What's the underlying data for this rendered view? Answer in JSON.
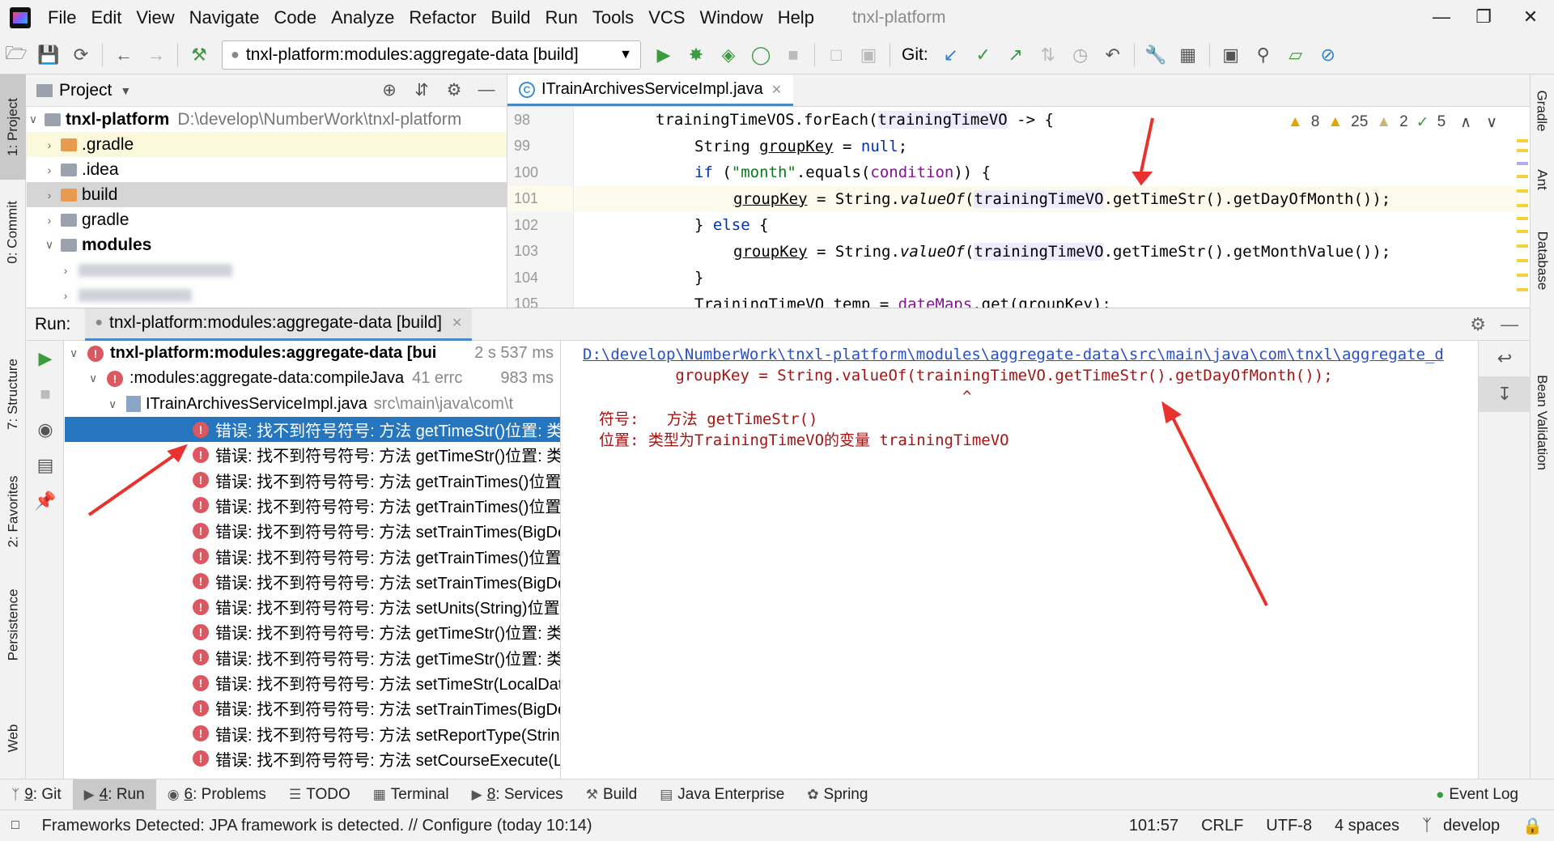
{
  "menubar": {
    "items": [
      "File",
      "Edit",
      "View",
      "Navigate",
      "Code",
      "Analyze",
      "Refactor",
      "Build",
      "Run",
      "Tools",
      "VCS",
      "Window",
      "Help"
    ],
    "project_title": "tnxl-platform"
  },
  "toolbar": {
    "run_config": "tnxl-platform:modules:aggregate-data [build]",
    "git_label": "Git:"
  },
  "left_stripe": {
    "tabs": [
      "1: Project",
      "0: Commit",
      "7: Structure",
      "2: Favorites",
      "Persistence",
      "Web"
    ]
  },
  "right_stripe": {
    "tabs": [
      "Gradle",
      "Ant",
      "Database",
      "Bean Validation"
    ]
  },
  "project": {
    "header": "Project",
    "root_name": "tnxl-platform",
    "root_path": "D:\\develop\\NumberWork\\tnxl-platform",
    "items": [
      ".gradle",
      ".idea",
      "build",
      "gradle",
      "modules"
    ]
  },
  "editor": {
    "tab_label": "ITrainArchivesServiceImpl.java",
    "line_numbers": [
      "98",
      "99",
      "100",
      "101",
      "102",
      "103",
      "104",
      "105"
    ],
    "inspections": {
      "warn_a": "8",
      "warn_b": "25",
      "weak": "2",
      "ok": "5"
    },
    "code": {
      "l98_a": "trainingTimeVOS",
      "l98_b": ".forEach(",
      "l98_c": "trainingTimeVO",
      "l98_d": " -> {",
      "l99_a": "String ",
      "l99_b": "groupKey",
      "l99_c": " = ",
      "l99_d": "null",
      "l99_e": ";",
      "l100_a": "if",
      "l100_b": " (",
      "l100_c": "\"month\"",
      "l100_d": ".equals(",
      "l100_e": "condition",
      "l100_f": ")) {",
      "l101_a": "groupKey",
      "l101_b": " = String.",
      "l101_c": "valueOf",
      "l101_d": "(",
      "l101_e": "trainingTimeVO",
      "l101_f": ".getTimeStr().getDayOfMonth());",
      "l102_a": "} ",
      "l102_b": "else",
      "l102_c": " {",
      "l103_a": "groupKey",
      "l103_b": " = String.",
      "l103_c": "valueOf",
      "l103_d": "(",
      "l103_e": "trainingTimeVO",
      "l103_f": ".getTimeStr().getMonthValue());",
      "l104_a": "}",
      "l105_a": "TrainingTimeVO temp = ",
      "l105_b": "dateMaps",
      "l105_c": ".get(groupKey);"
    }
  },
  "run": {
    "label": "Run:",
    "tab": "tnxl-platform:modules:aggregate-data [build]",
    "tree": {
      "root": "tnxl-platform:modules:aggregate-data [bui",
      "root_time": "2 s 537 ms",
      "task": ":modules:aggregate-data:compileJava",
      "task_errors": "41 errc",
      "task_time": "983 ms",
      "file": "ITrainArchivesServiceImpl.java",
      "file_path": "src\\main\\java\\com\\t",
      "errors": [
        "错误: 找不到符号符号:   方法 getTimeStr()位置: 类",
        "错误: 找不到符号符号:   方法 getTimeStr()位置: 类",
        "错误: 找不到符号符号:   方法 getTrainTimes()位置:",
        "错误: 找不到符号符号:   方法 getTrainTimes()位置:",
        "错误: 找不到符号符号:   方法 setTrainTimes(BigDe",
        "错误: 找不到符号符号:   方法 getTrainTimes()位置:",
        "错误: 找不到符号符号:   方法 setTrainTimes(BigDe",
        "错误: 找不到符号符号:   方法 setUnits(String)位置:",
        "错误: 找不到符号符号:   方法 getTimeStr()位置: 类",
        "错误: 找不到符号符号:   方法 getTimeStr()位置: 类",
        "错误: 找不到符号符号:   方法 setTimeStr(LocalDate",
        "错误: 找不到符号符号:   方法 setTrainTimes(BigDe",
        "错误: 找不到符号符号:   方法 setReportType(String",
        "错误: 找不到符号符号:   方法 setCourseExecute(Lo"
      ]
    },
    "console": {
      "path": "D:\\develop\\NumberWork\\tnxl-platform\\modules\\aggregate-data\\src\\main\\java\\com\\tnxl\\aggregate_d",
      "code_line": "          groupKey = String.valueOf(trainingTimeVO.getTimeStr().getDayOfMonth());",
      "caret": "                                         ^",
      "symbol_line": "符号:   方法 getTimeStr()",
      "location_line": "位置: 类型为TrainingTimeVO的变量 trainingTimeVO"
    }
  },
  "bottom_tabs": [
    {
      "num": "9",
      "label": ": Git"
    },
    {
      "num": "4",
      "label": ": Run"
    },
    {
      "num": "6",
      "label": ": Problems"
    },
    {
      "num": "",
      "label": "TODO"
    },
    {
      "num": "",
      "label": "Terminal"
    },
    {
      "num": "8",
      "label": ": Services"
    },
    {
      "num": "",
      "label": "Build"
    },
    {
      "num": "",
      "label": "Java Enterprise"
    },
    {
      "num": "",
      "label": "Spring"
    }
  ],
  "event_log": "Event Log",
  "status": {
    "message": "Frameworks Detected: JPA framework is detected. // Configure (today 10:14)",
    "position": "101:57",
    "line_sep": "CRLF",
    "encoding": "UTF-8",
    "indent": "4 spaces",
    "branch": "develop"
  },
  "colors": {
    "accent": "#2675bf",
    "error": "#db5860",
    "annotation": "#e8322d"
  }
}
